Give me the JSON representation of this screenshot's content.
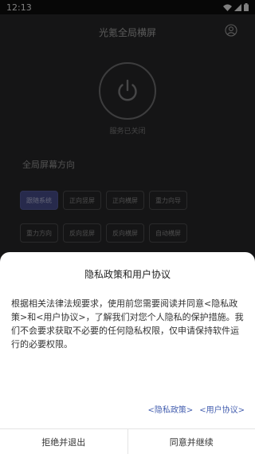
{
  "status_bar": {
    "time": "12:13"
  },
  "header": {
    "title": "光氪全局横屏",
    "profile_icon": "person-circle-icon"
  },
  "power": {
    "icon": "power-icon",
    "status": "服务已关闭"
  },
  "orientation": {
    "label": "全局屏幕方向",
    "modes": [
      {
        "label": "跟随系统",
        "active": true
      },
      {
        "label": "正向竖屏",
        "active": false
      },
      {
        "label": "正向横屏",
        "active": false
      },
      {
        "label": "重力向导",
        "active": false
      },
      {
        "label": "重力方向",
        "active": false
      },
      {
        "label": "反向竖屏",
        "active": false
      },
      {
        "label": "反向横屏",
        "active": false
      },
      {
        "label": "自动横屏",
        "active": false
      }
    ]
  },
  "dialog": {
    "title": "隐私政策和用户协议",
    "body": "根据相关法律法规要求，使用前您需要阅读并同意<隐私政策>和<用户协议>，了解我们对您个人隐私的保护措施。我们不会要求获取不必要的任何隐私权限，仅申请保持软件运行的必要权限。",
    "privacy_link": "<隐私政策>",
    "terms_link": "<用户协议>",
    "reject_label": "拒绝并退出",
    "accept_label": "同意并继续"
  },
  "colors": {
    "accent": "#4e5599",
    "link": "#4660b0",
    "background": "#2a2a2c"
  }
}
